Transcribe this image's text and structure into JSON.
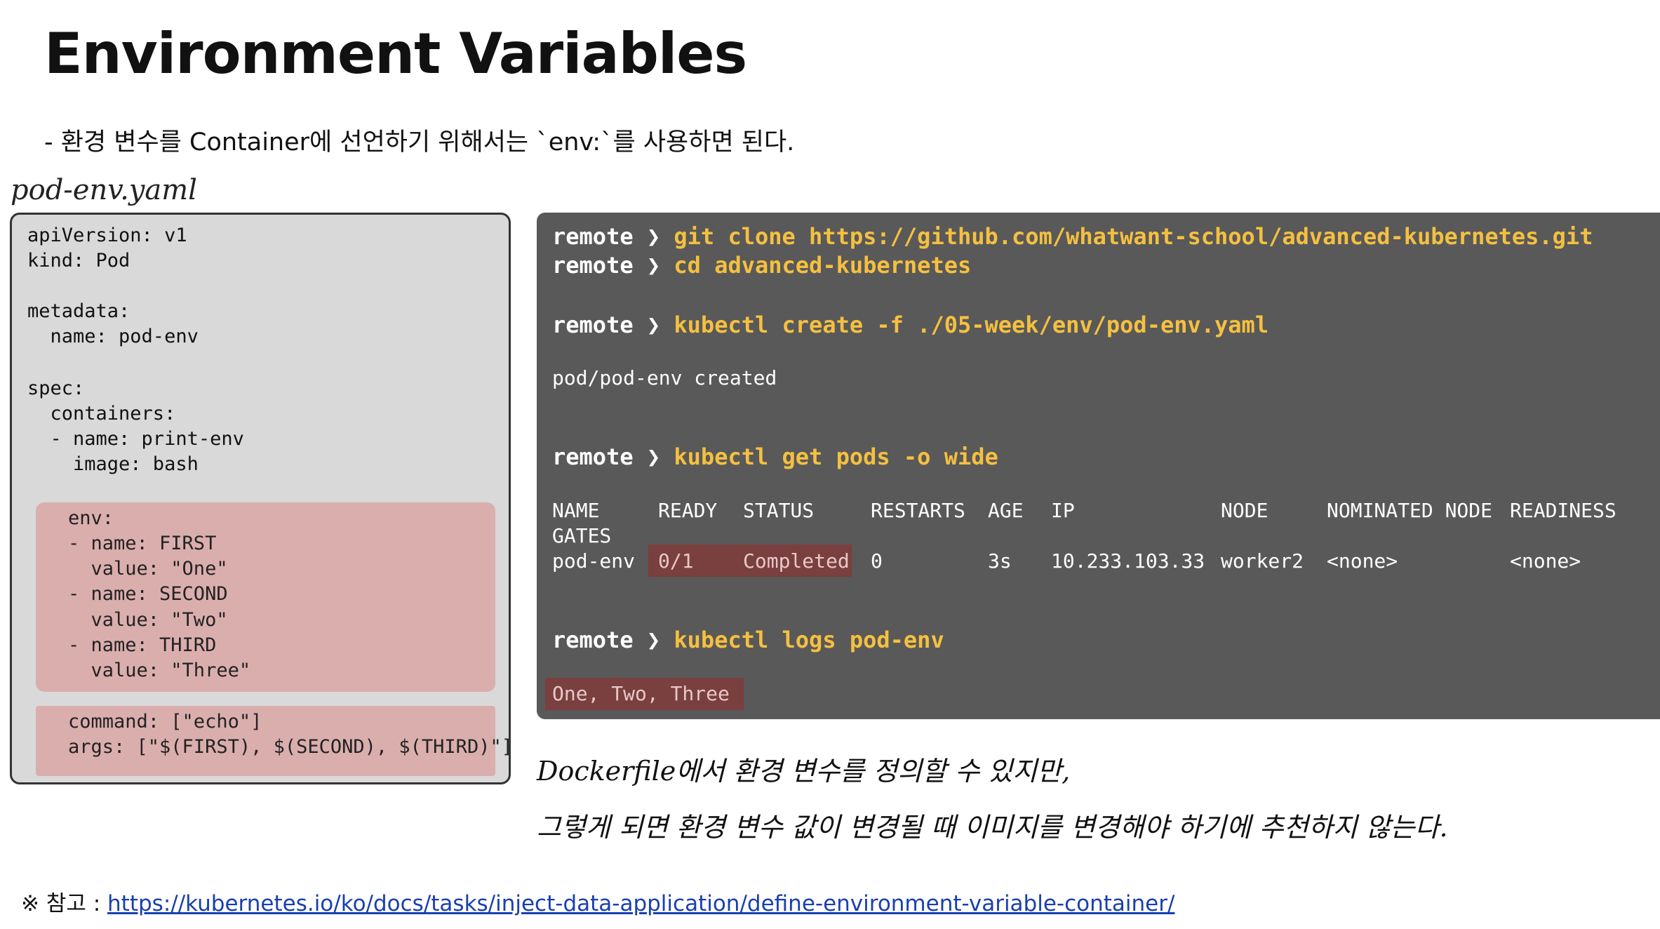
{
  "title": "Environment Variables",
  "subtitle": "- 환경 변수를 Container에 선언하기 위해서는 `env:`를 사용하면 된다.",
  "file_label": "pod-env.yaml",
  "yaml": {
    "lines": [
      "apiVersion: v1",
      "kind: Pod",
      "",
      "metadata:",
      "  name: pod-env",
      "",
      "spec:",
      "  containers:",
      "  - name: print-env",
      "    image: bash"
    ],
    "env_lines": [
      "env:",
      "- name: FIRST",
      "  value: \"One\"",
      "- name: SECOND",
      "  value: \"Two\"",
      "- name: THIRD",
      "  value: \"Three\""
    ],
    "cmd_lines": [
      "command: [\"echo\"]",
      "args: [\"$(FIRST), $(SECOND), $(THIRD)\"]"
    ]
  },
  "terminal": {
    "prompt": "remote ❯",
    "commands": [
      "git clone https://github.com/whatwant-school/advanced-kubernetes.git",
      "cd advanced-kubernetes",
      "kubectl create -f ./05-week/env/pod-env.yaml",
      "kubectl get pods -o wide",
      "kubectl logs pod-env"
    ],
    "create_output": "pod/pod-env created",
    "table_headers": [
      "NAME",
      "READY",
      "STATUS",
      "RESTARTS",
      "AGE",
      "IP",
      "NODE",
      "NOMINATED NODE",
      "READINESS"
    ],
    "table_headers_wrap": "GATES",
    "table_row": [
      "pod-env",
      "0/1",
      "Completed",
      "0",
      "3s",
      "10.233.103.33",
      "worker2",
      "<none>",
      "<none>"
    ],
    "logs_output": "One, Two, Three"
  },
  "notes": [
    "Dockerfile에서 환경 변수를 정의할 수 있지만,",
    "그렇게 되면 환경 변수 값이 변경될 때 이미지를 변경해야 하기에 추천하지 않는다."
  ],
  "reference": {
    "prefix": "※ 참고 : ",
    "link": "https://kubernetes.io/ko/docs/tasks/inject-data-application/define-environment-variable-container/"
  }
}
